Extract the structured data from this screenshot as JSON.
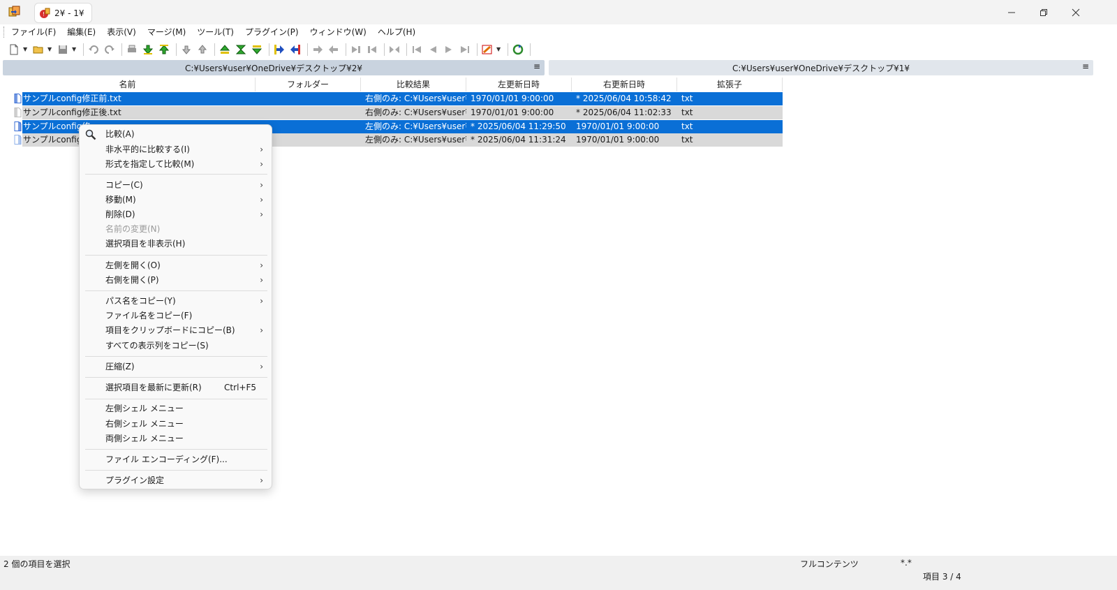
{
  "title_tab": "2¥ - 1¥",
  "menu": [
    "ファイル(F)",
    "編集(E)",
    "表示(V)",
    "マージ(M)",
    "ツール(T)",
    "プラグイン(P)",
    "ウィンドウ(W)",
    "ヘルプ(H)"
  ],
  "paths": {
    "left": "C:¥Users¥user¥OneDrive¥デスクトップ¥2¥",
    "right": "C:¥Users¥user¥OneDrive¥デスクトップ¥1¥",
    "menu_glyph": "≡"
  },
  "columns": [
    "名前",
    "フォルダー",
    "比較結果",
    "左更新日時",
    "右更新日時",
    "拡張子"
  ],
  "rows": [
    {
      "name": "サンプルconfig修正前.txt",
      "folder": "",
      "result": "右側のみ: C:¥Users¥user¥...",
      "left_date": "1970/01/01 9:00:00",
      "right_date": "* 2025/06/04 10:58:42",
      "ext": "txt"
    },
    {
      "name": "サンプルconfig修正後.txt",
      "folder": "",
      "result": "右側のみ: C:¥Users¥user¥...",
      "left_date": "1970/01/01 9:00:00",
      "right_date": "* 2025/06/04 11:02:33",
      "ext": "txt"
    },
    {
      "name": "サンプルconfig修",
      "folder": "",
      "result": "左側のみ: C:¥Users¥user¥...",
      "left_date": "* 2025/06/04 11:29:50",
      "right_date": "1970/01/01 9:00:00",
      "ext": "txt"
    },
    {
      "name": "サンプルconfig修",
      "folder": "",
      "result": "左側のみ: C:¥Users¥user¥...",
      "left_date": "* 2025/06/04 11:31:24",
      "right_date": "1970/01/01 9:00:00",
      "ext": "txt"
    }
  ],
  "context_menu": {
    "compare": "比較(A)",
    "items": [
      "非水平的に比較する(I)",
      "形式を指定して比較(M)",
      "コピー(C)",
      "移動(M)",
      "削除(D)",
      "名前の変更(N)",
      "選択項目を非表示(H)",
      "左側を開く(O)",
      "右側を開く(P)",
      "パス名をコピー(Y)",
      "ファイル名をコピー(F)",
      "項目をクリップボードにコピー(B)",
      "すべての表示列をコピー(S)",
      "圧縮(Z)",
      "選択項目を最新に更新(R)",
      "左側シェル メニュー",
      "右側シェル メニュー",
      "両側シェル メニュー",
      "ファイル エンコーディング(F)...",
      "プラグイン設定"
    ],
    "refresh_shortcut": "Ctrl+F5",
    "arrow": "›"
  },
  "status": {
    "selection": "2 個の項目を選択",
    "mode": "フルコンテンツ",
    "filter": "*.*",
    "item_count": "項目 3 / 4"
  },
  "colors": {
    "selected": "#0a6fd6",
    "grey_row": "#d9d9d9",
    "pathbar_left": "#c9d3df",
    "pathbar_right": "#e1e6ec"
  }
}
